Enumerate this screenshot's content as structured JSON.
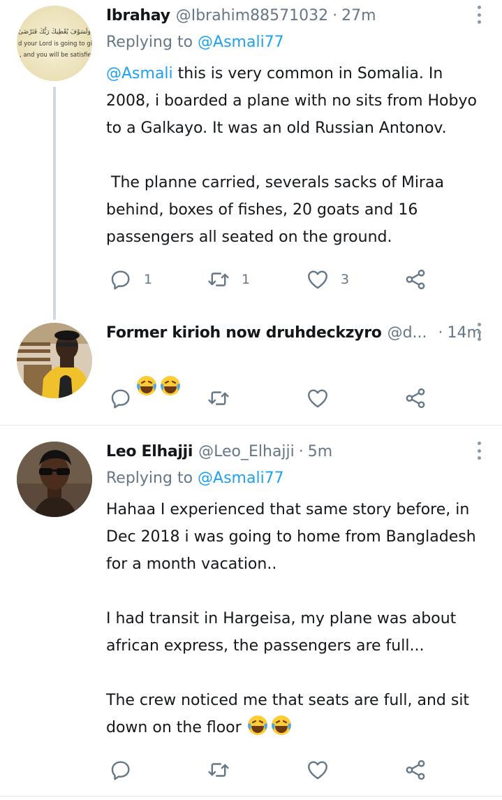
{
  "tweets": [
    {
      "name": "Ibrahay",
      "handle": "@Ibrahim88571032",
      "dot": "·",
      "time": "27m",
      "reply_prefix": "Replying to ",
      "reply_handle": "@Asmali77",
      "mention": "@Asmali",
      "text": " this is very common in Somalia. In 2008, i boarded a plane with no sits from Hobyo to a Galkayo. It was an old Russian Antonov.\n\n The planne carried, severals sacks of Miraa behind, boxes of fishes, 20 goats and 16 passengers all seated on the ground.",
      "avatar_text": [
        "وَلَسَوْفَ يُعْطِيكَ رَبُّكَ فَتَرْضَىٰ",
        "d your Lord is going to gi",
        ", and you will be satisfie"
      ],
      "replies": "1",
      "retweets": "1",
      "likes": "3"
    },
    {
      "name": "Former kirioh now druhdeckzyro",
      "handle": "@d...",
      "dot": "·",
      "time": "14m"
    },
    {
      "name": "Leo Elhajji",
      "handle": "@Leo_Elhajji",
      "dot": "·",
      "time": "5m",
      "reply_prefix": "Replying to ",
      "reply_handle": "@Asmali77",
      "text_1": "Hahaa I experienced that same story before, in Dec 2018 i was going to home from Bangladesh for a month vacation..\n\nI had transit in Hargeisa, my plane was about african express, the passengers are full...\n\nThe crew noticed me that seats are full, and sit down on the floor "
    }
  ],
  "colors": {
    "mention": "#1da1f2",
    "secondary": "#657786",
    "thread_line": "#cfd9de",
    "divider": "#e1e8ed"
  },
  "icons": [
    "reply-icon",
    "retweet-icon",
    "like-icon",
    "share-icon",
    "more-icon",
    "laughing-emoji"
  ]
}
